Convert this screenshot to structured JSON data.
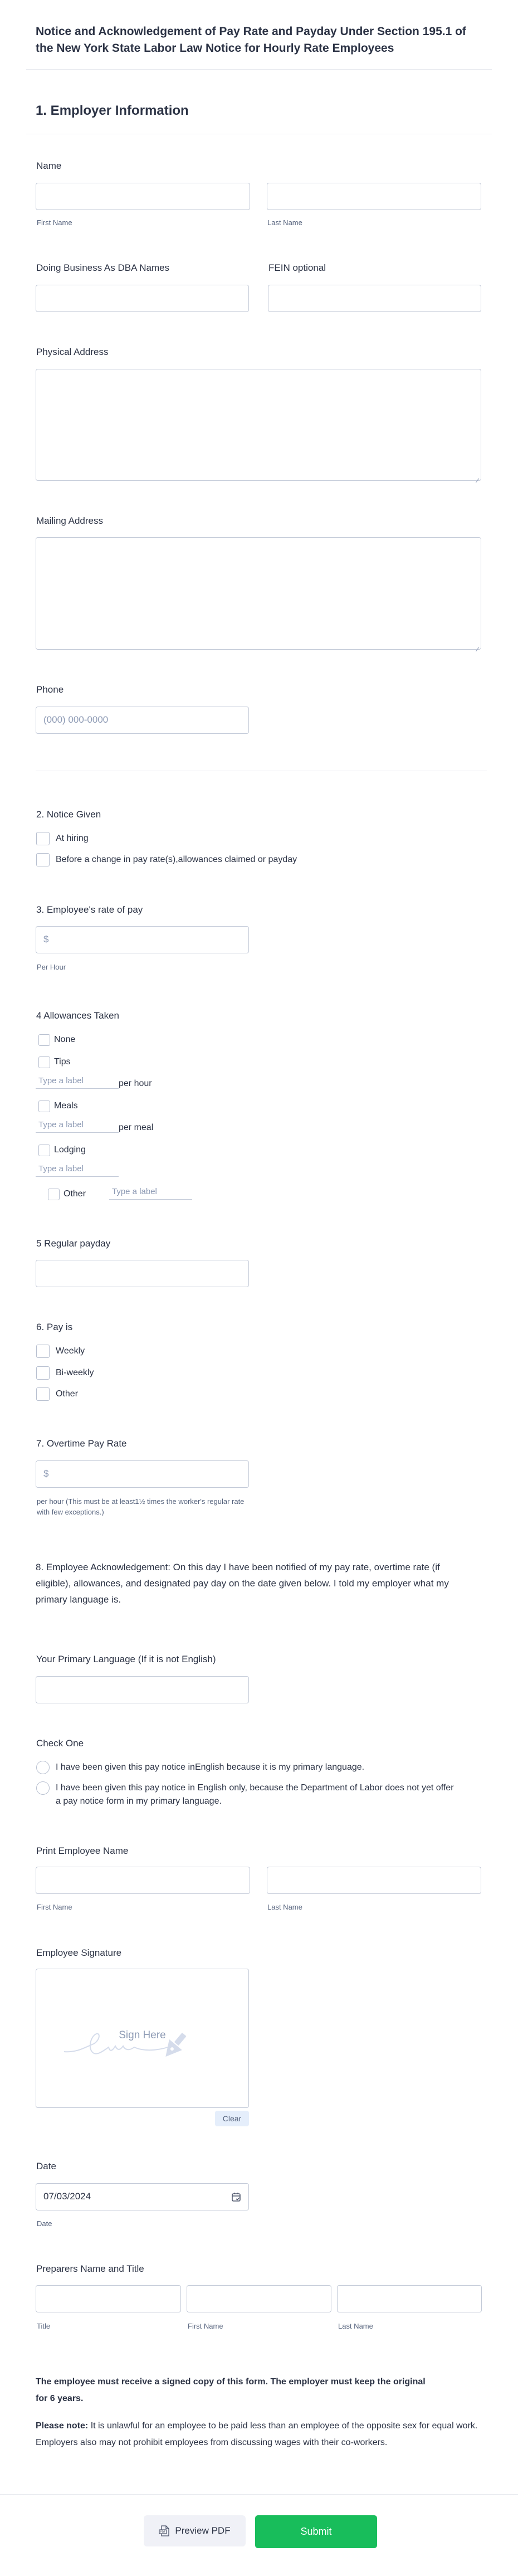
{
  "header": {
    "title": "Notice and Acknowledgement of Pay Rate and Payday Under Section 195.1 of the New York State Labor Law Notice for Hourly Rate Employees"
  },
  "section1": {
    "heading": "1. Employer Information",
    "name": {
      "label": "Name",
      "first_sublabel": "First Name",
      "last_sublabel": "Last Name",
      "first_value": "",
      "last_value": ""
    },
    "dba": {
      "label": "Doing Business As DBA Names",
      "value": ""
    },
    "fein": {
      "label": "FEIN optional",
      "value": ""
    },
    "physical_address": {
      "label": "Physical Address",
      "value": ""
    },
    "mailing_address": {
      "label": "Mailing Address",
      "value": ""
    },
    "phone": {
      "label": "Phone",
      "placeholder": "(000) 000-0000",
      "value": ""
    }
  },
  "notice_given": {
    "label": "2. Notice Given",
    "options": [
      {
        "label": "At hiring",
        "checked": false
      },
      {
        "label": "Before a change in pay rate(s),allowances claimed or payday",
        "checked": false
      }
    ]
  },
  "rate_of_pay": {
    "label": "3. Employee's rate of pay",
    "placeholder": "$",
    "sublabel": "Per Hour"
  },
  "allowances": {
    "label": "4 Allowances Taken",
    "none": {
      "label": "None",
      "checked": false
    },
    "tips": {
      "label": "Tips",
      "checked": false,
      "input_placeholder": "Type a label",
      "suffix": "per hour"
    },
    "meals": {
      "label": "Meals",
      "checked": false,
      "input_placeholder": "Type a label",
      "suffix": "per meal"
    },
    "lodging": {
      "label": "Lodging",
      "checked": false,
      "input_placeholder": "Type a label"
    },
    "other": {
      "label": "Other",
      "checked": false,
      "input_placeholder": "Type a label"
    }
  },
  "regular_payday": {
    "label": "5 Regular payday",
    "value": ""
  },
  "pay_is": {
    "label": "6. Pay is",
    "options": [
      {
        "label": "Weekly",
        "checked": false
      },
      {
        "label": "Bi-weekly",
        "checked": false
      },
      {
        "label": "Other",
        "checked": false
      }
    ]
  },
  "overtime": {
    "label": "7. Overtime Pay Rate",
    "placeholder": "$",
    "sublabel": "per hour (This must be at least1½ times the worker's regular rate with few exceptions.)"
  },
  "acknowledgement": {
    "text": "8. Employee Acknowledgement: On this day I have been notified of my pay rate, overtime rate (if eligible), allowances, and designated pay day on the date given below. I told my employer what my primary language is."
  },
  "primary_language": {
    "label": "Your Primary Language (If it is not English)",
    "value": ""
  },
  "check_one": {
    "label": "Check One",
    "options": [
      {
        "label": "I have been given this pay notice inEnglish because it is my primary language.",
        "selected": false
      },
      {
        "label": "I have been given this pay notice in English only, because the Department of Labor does not yet offer a pay notice form in my primary language.",
        "selected": false
      }
    ]
  },
  "employee_name": {
    "label": "Print Employee Name",
    "first_sublabel": "First Name",
    "last_sublabel": "Last Name"
  },
  "signature": {
    "label": "Employee Signature",
    "placeholder": "Sign Here",
    "clear_label": "Clear"
  },
  "date": {
    "label": "Date",
    "value": "07/03/2024",
    "sublabel": "Date"
  },
  "preparer": {
    "label": "Preparers Name and Title",
    "sublabels": [
      "Title",
      "First Name",
      "Last Name"
    ]
  },
  "notes": {
    "bold_note": "The employee must receive a signed copy of this form. The employer must keep the original for 6 years.",
    "please_note_prefix": "Please note:",
    "please_note_text": " It is unlawful for an employee to be paid less than an employee of the opposite sex for equal work. Employers also may not prohibit employees from discussing wages with their co-workers."
  },
  "actions": {
    "preview_label": "Preview PDF",
    "submit_label": "Submit"
  },
  "colors": {
    "submit": "#18bd5b",
    "text": "#2c3345",
    "border": "#c3cad8",
    "clear_bg": "#e5eefb"
  }
}
